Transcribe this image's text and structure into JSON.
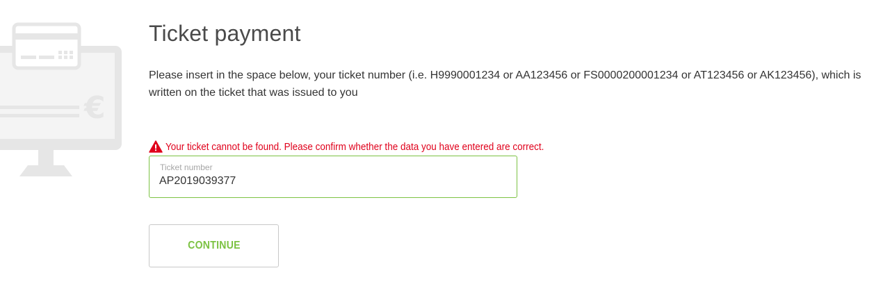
{
  "page": {
    "title": "Ticket payment",
    "instructions": "Please insert in the space below, your ticket number (i.e. H9990001234 or AA123456 or FS0000200001234 or AT123456 or AK123456), which is written on the ticket that was issued to you"
  },
  "error": {
    "icon": "warning-triangle-icon",
    "message": "Your ticket cannot be found. Please confirm whether the data you have entered are correct."
  },
  "ticket_field": {
    "label": "Ticket number",
    "value": "AP2019039377"
  },
  "continue_button": {
    "label": "CONTINUE"
  },
  "colors": {
    "accent_green": "#7cc242",
    "error_red": "#e0001b",
    "illustration_gray": "#e6e6e6"
  },
  "illustration": {
    "icon": "monitor-payment-card-euro-icon",
    "currency_symbol": "€"
  }
}
